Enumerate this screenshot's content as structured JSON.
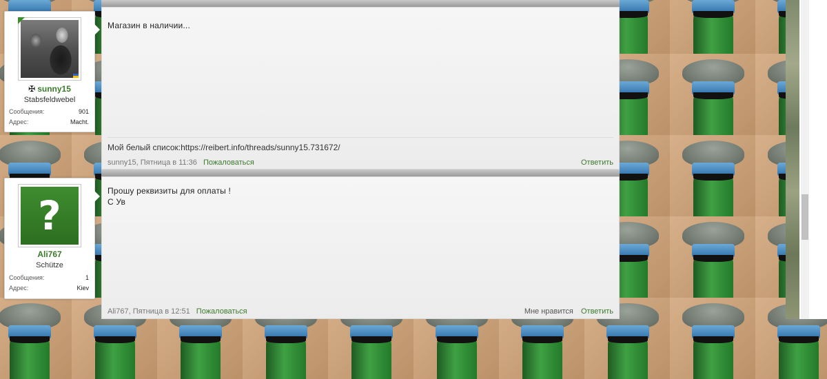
{
  "colors": {
    "accent_green": "#3b7a2a",
    "post_background": "#f0f0f0",
    "separator": "#a8a8a8"
  },
  "posts": [
    {
      "user": {
        "name": "sunny15",
        "rank_icon": "iron-cross-icon",
        "title": "Stabsfeldwebel",
        "stats": [
          {
            "label": "Сообщения:",
            "value": "901"
          },
          {
            "label": "Адрес:",
            "value": "Macht."
          }
        ]
      },
      "message": [
        "Магазин в наличии..."
      ],
      "signature": "Мой белый список:https://reibert.info/threads/sunny15.731672/",
      "meta": {
        "author_time": "sunny15, Пятница в 11:36",
        "report": "Пожаловаться",
        "reply": "Ответить"
      }
    },
    {
      "user": {
        "name": "Ali767",
        "title": "Schütze",
        "avatar_text": "?",
        "stats": [
          {
            "label": "Сообщения:",
            "value": "1"
          },
          {
            "label": "Адрес:",
            "value": "Kiev"
          }
        ]
      },
      "message": [
        "Прошу реквизиты для оплаты !",
        "С Ув"
      ],
      "meta": {
        "author_time": "Ali767, Пятница в 12:51",
        "report": "Пожаловаться",
        "like": "Мне нравится",
        "reply": "Ответить"
      }
    }
  ]
}
